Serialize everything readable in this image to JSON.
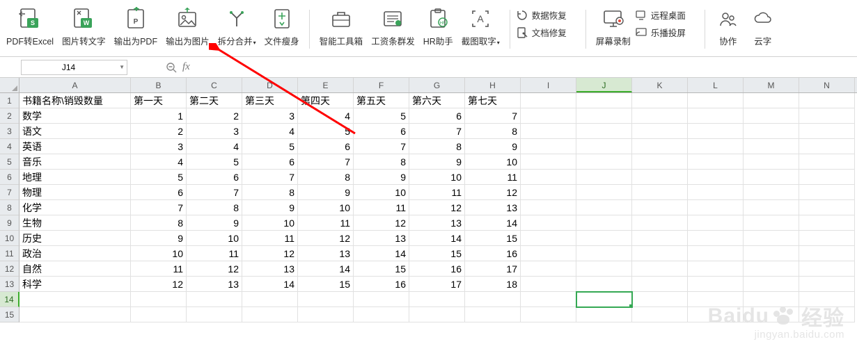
{
  "toolbar": {
    "items": [
      {
        "label": "PDF转Excel"
      },
      {
        "label": "图片转文字"
      },
      {
        "label": "输出为PDF"
      },
      {
        "label": "输出为图片"
      },
      {
        "label": "拆分合并",
        "drop": true
      },
      {
        "label": "文件瘦身"
      },
      {
        "label": "智能工具箱"
      },
      {
        "label": "工资条群发"
      },
      {
        "label": "HR助手"
      },
      {
        "label": "截图取字",
        "drop": true
      }
    ],
    "side1": [
      {
        "label": "数据恢复"
      },
      {
        "label": "文档修复"
      }
    ],
    "side2a": {
      "label": "屏幕录制"
    },
    "side2b": [
      {
        "label": "远程桌面"
      },
      {
        "label": "乐播投屏"
      }
    ],
    "far": [
      {
        "label": "协作"
      },
      {
        "label": "云字"
      }
    ]
  },
  "namebox": {
    "value": "J14"
  },
  "fx": {
    "label": "fx",
    "value": ""
  },
  "columns": [
    "A",
    "B",
    "C",
    "D",
    "E",
    "F",
    "G",
    "H",
    "I",
    "J",
    "K",
    "L",
    "M",
    "N"
  ],
  "active_col": "J",
  "active_row": 14,
  "row_count": 15,
  "header_row": [
    "书籍名称\\销毁数量",
    "第一天",
    "第二天",
    "第三天",
    "第四天",
    "第五天",
    "第六天",
    "第七天"
  ],
  "data_rows": [
    [
      "数学",
      1,
      2,
      3,
      4,
      5,
      6,
      7
    ],
    [
      "语文",
      2,
      3,
      4,
      5,
      6,
      7,
      8
    ],
    [
      "英语",
      3,
      4,
      5,
      6,
      7,
      8,
      9
    ],
    [
      "音乐",
      4,
      5,
      6,
      7,
      8,
      9,
      10
    ],
    [
      "地理",
      5,
      6,
      7,
      8,
      9,
      10,
      11
    ],
    [
      "物理",
      6,
      7,
      8,
      9,
      10,
      11,
      12
    ],
    [
      "化学",
      7,
      8,
      9,
      10,
      11,
      12,
      13
    ],
    [
      "生物",
      8,
      9,
      10,
      11,
      12,
      13,
      14
    ],
    [
      "历史",
      9,
      10,
      11,
      12,
      13,
      14,
      15
    ],
    [
      "政治",
      10,
      11,
      12,
      13,
      14,
      15,
      16
    ],
    [
      "自然",
      11,
      12,
      13,
      14,
      15,
      16,
      17
    ],
    [
      "科学",
      12,
      13,
      14,
      15,
      16,
      17,
      18
    ]
  ],
  "watermark": {
    "main": "Baidu",
    "sup": "经验",
    "sub": "jingyan.baidu.com"
  }
}
